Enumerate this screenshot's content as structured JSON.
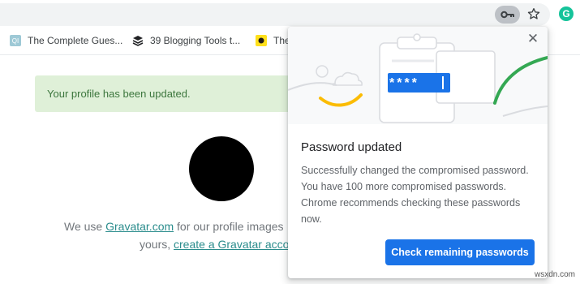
{
  "toolbar": {
    "key_icon": "key-icon",
    "star_icon": "star-icon",
    "extension_letter": "G"
  },
  "bookmarks": [
    {
      "label": "The Complete Gues...",
      "favicon": "QI"
    },
    {
      "label": "39 Blogging Tools t...",
      "favicon": "stack-icon"
    },
    {
      "label": "The",
      "favicon": "mailchimp-icon"
    }
  ],
  "page": {
    "alert": "Your profile has been updated.",
    "gravatar_line1_prefix": "We use ",
    "gravatar_link": "Gravatar.com",
    "gravatar_line1_suffix": " for our profile images",
    "gravatar_line2_prefix": "yours, ",
    "gravatar_line2_link": "create a Gravatar accou"
  },
  "popup": {
    "masked_password": "****",
    "title": "Password updated",
    "body": "Successfully changed the compromised password. You have 100 more compromised passwords. Chrome recommends checking these passwords now.",
    "button": "Check remaining passwords",
    "close_icon": "close-icon"
  },
  "watermark": "wsxdn.com",
  "colors": {
    "accent": "#1a73e8",
    "alert_bg": "#dff0d8",
    "alert_text": "#3c763d",
    "link": "#2a8c8c"
  }
}
